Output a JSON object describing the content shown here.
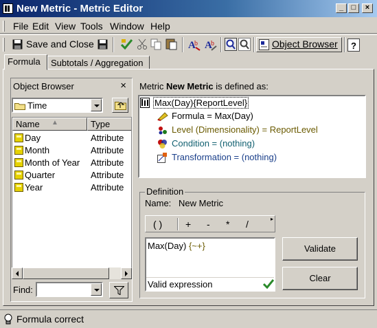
{
  "window": {
    "title": "New Metric - Metric Editor",
    "minimize": "_",
    "maximize": "□",
    "close": "×"
  },
  "menu": [
    {
      "label": "File"
    },
    {
      "label": "Edit"
    },
    {
      "label": "View"
    },
    {
      "label": "Tools"
    },
    {
      "label": "Window"
    },
    {
      "label": "Help"
    }
  ],
  "toolbar": {
    "save_close": "Save and Close",
    "object_browser": "Object Browser",
    "help": "?"
  },
  "tabs": [
    {
      "label": "Formula"
    },
    {
      "label": "Subtotals / Aggregation"
    }
  ],
  "object_browser": {
    "title": "Object Browser",
    "close": "×",
    "folder": "Time",
    "columns": {
      "name": "Name",
      "type": "Type"
    },
    "items": [
      {
        "name": "Day",
        "type": "Attribute"
      },
      {
        "name": "Month",
        "type": "Attribute"
      },
      {
        "name": "Month of Year",
        "type": "Attribute"
      },
      {
        "name": "Quarter",
        "type": "Attribute"
      },
      {
        "name": "Year",
        "type": "Attribute"
      }
    ],
    "find_label": "Find:",
    "find_value": ""
  },
  "definition_header": {
    "prefix": "Metric",
    "name": "New Metric",
    "suffix": "is defined as:"
  },
  "tree": {
    "root": "Max(Day){ReportLevel}",
    "formula": "Formula = Max(Day)",
    "level": "Level (Dimensionality) = ReportLevel",
    "condition": "Condition = (nothing)",
    "transformation": "Transformation = (nothing)"
  },
  "definition": {
    "legend": "Definition",
    "name_label": "Name:",
    "name_value": "New Metric",
    "operators": [
      "( )",
      "+",
      "-",
      "*",
      "/"
    ],
    "formula_main": "Max(Day)",
    "formula_suffix": "{~+}",
    "validation": "Valid expression",
    "validate_button": "Validate",
    "clear_button": "Clear"
  },
  "status": {
    "text": "Formula correct"
  },
  "colors": {
    "title_start": "#0a246a",
    "title_end": "#a6caf0",
    "face": "#d4d0c8",
    "link_blue": "#1a3f8a"
  }
}
